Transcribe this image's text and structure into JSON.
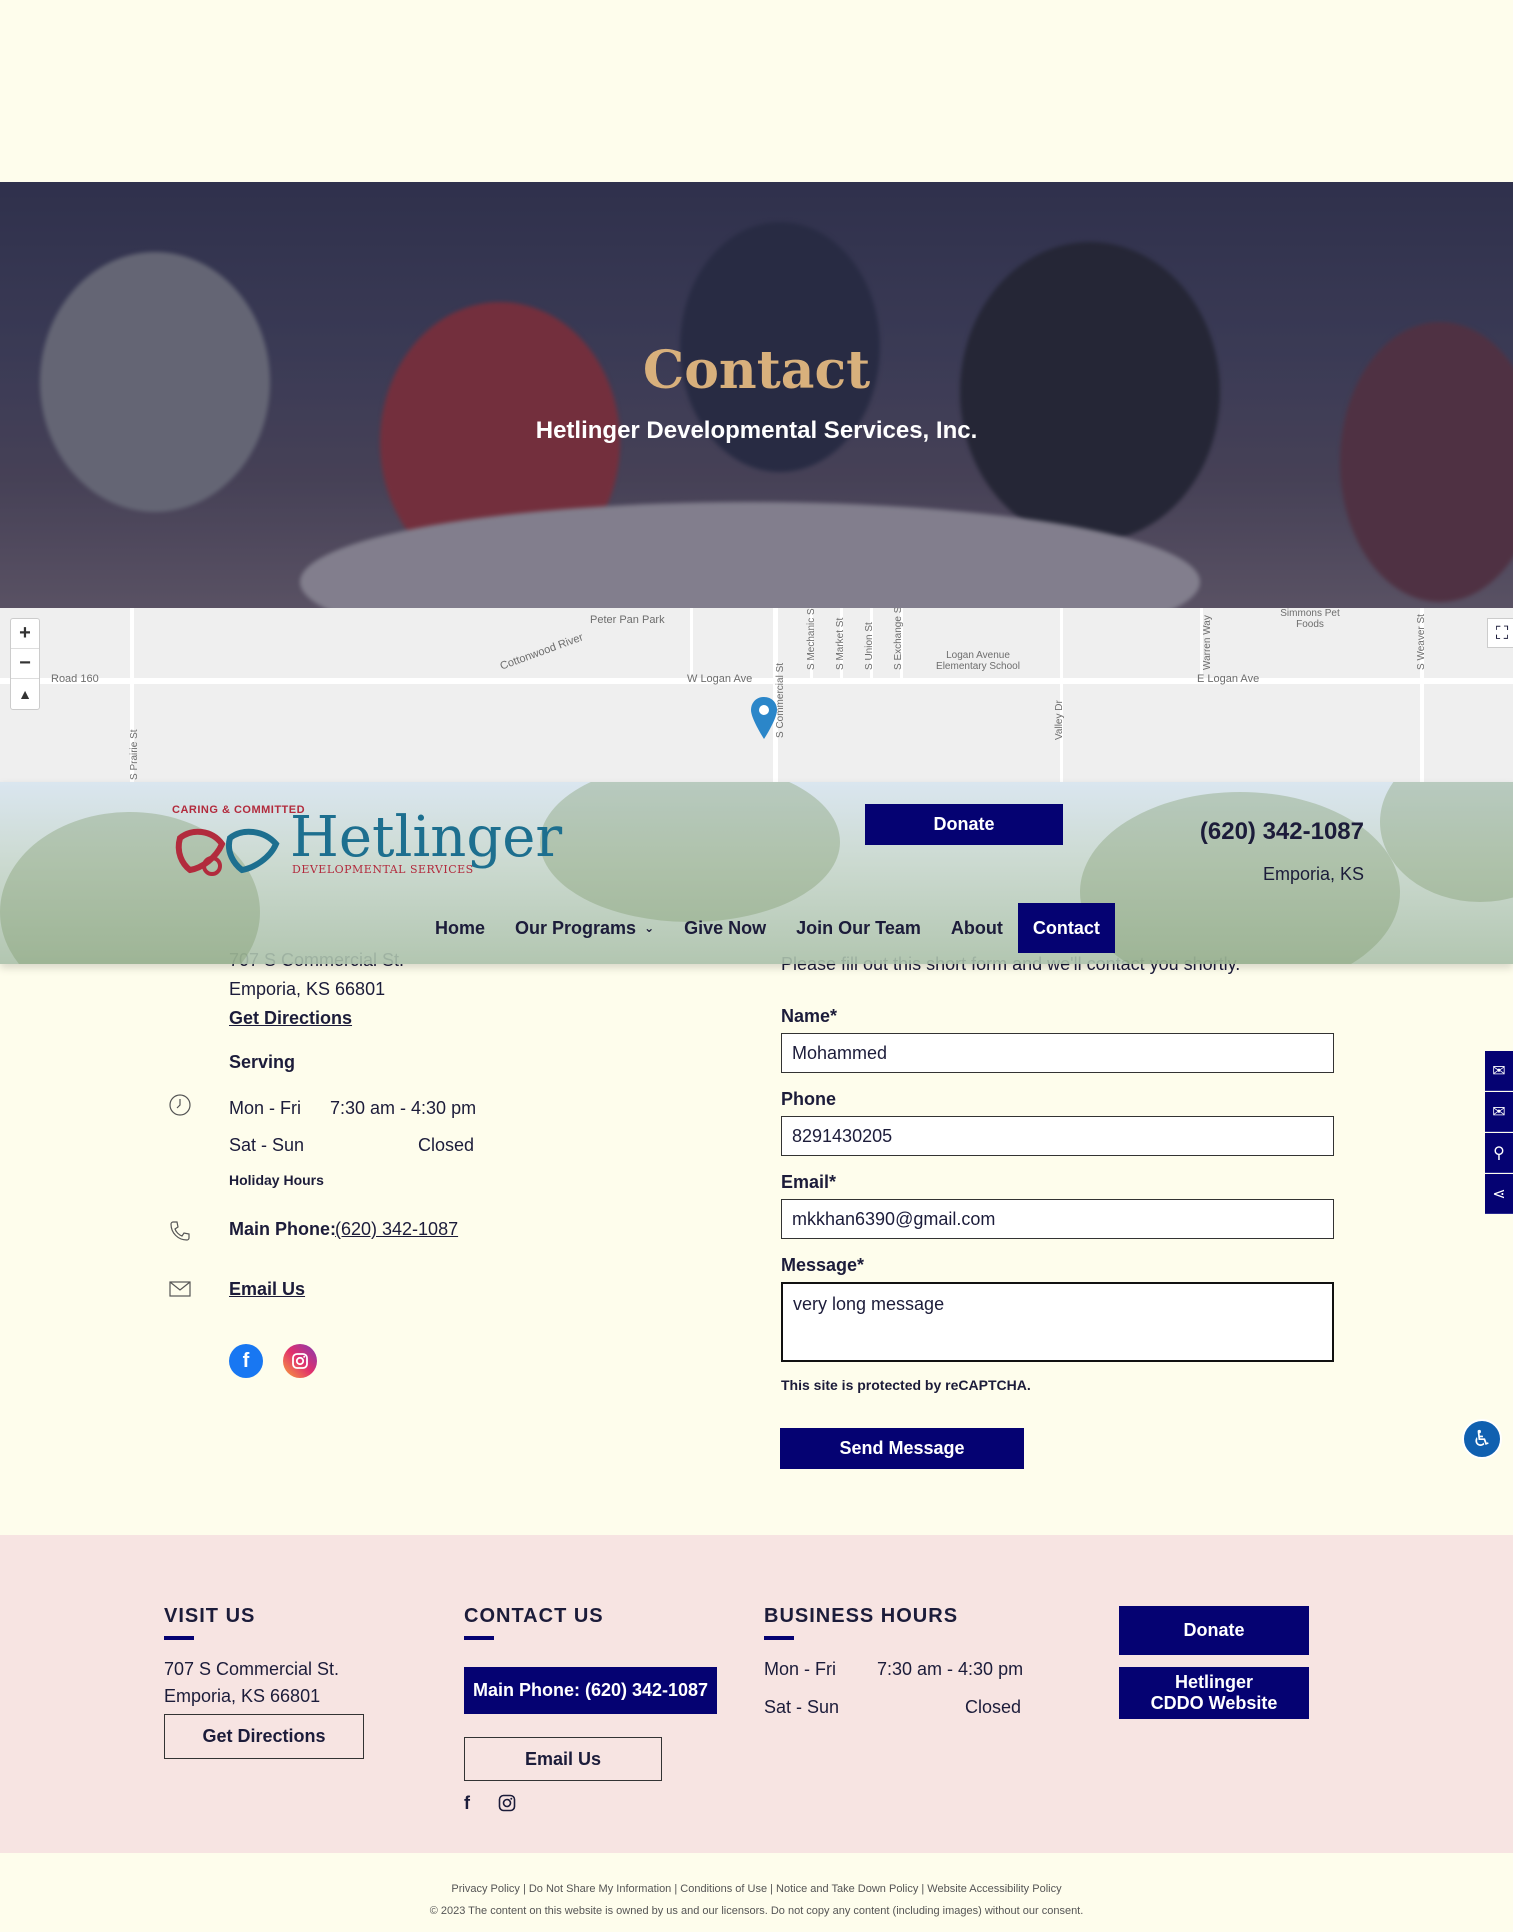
{
  "hero": {
    "title": "Contact",
    "subtitle": "Hetlinger Developmental Services, Inc."
  },
  "map": {
    "labels": {
      "peter_pan_park": "Peter Pan Park",
      "road_160": "Road 160",
      "cottonwood_river": "Cottonwood River",
      "w_logan_ave": "W Logan Ave",
      "logan_school": "Logan Avenue Elementary School",
      "e_logan_ave": "E Logan Ave",
      "simmons": "Simmons Pet Foods",
      "s_prairie": "S Prairie St",
      "s_commercial": "S Commercial St",
      "s_mechanic": "S Mechanic St",
      "s_market": "S Market St",
      "s_union": "S Union St",
      "s_exchange": "S Exchange St",
      "valley_dr": "Valley Dr",
      "warren_way": "Warren Way",
      "s_weaver": "S Weaver St"
    },
    "zoom_in": "+",
    "zoom_out": "−",
    "reset": "▲"
  },
  "header": {
    "logo_tagline": "CARING & COMMITTED",
    "logo_word": "Hetlinger",
    "logo_sub": "DEVELOPMENTAL SERVICES",
    "donate": "Donate",
    "phone": "(620) 342-1087",
    "city": "Emporia, KS"
  },
  "nav": {
    "items": [
      "Home",
      "Our Programs",
      "Give Now",
      "Join Our Team",
      "About",
      "Contact"
    ],
    "chevron": "⌄"
  },
  "contact": {
    "address_line1": "707 S Commercial St.",
    "address_line2": "Emporia, KS 66801",
    "directions": "Get Directions",
    "serving": "Serving",
    "hours": [
      {
        "days": "Mon - Fri",
        "time": "7:30 am - 4:30 pm"
      },
      {
        "days": "Sat - Sun",
        "time": "Closed"
      }
    ],
    "holiday": "Holiday Hours",
    "phone_label": "Main Phone:",
    "phone": "(620) 342-1087",
    "email": "Email Us"
  },
  "form": {
    "intro": "Please fill out this short form and we'll contact you shortly.",
    "name_label": "Name*",
    "name_value": "Mohammed",
    "phone_label": "Phone",
    "phone_value": "8291430205",
    "email_label": "Email*",
    "email_value": "mkkhan6390@gmail.com",
    "message_label": "Message*",
    "message_value": "very long message",
    "recaptcha": "This site is protected by reCAPTCHA.",
    "send": "Send Message"
  },
  "footer": {
    "visit_heading": "VISIT US",
    "visit_line1": "707 S Commercial St.",
    "visit_line2": "Emporia, KS 66801",
    "directions": "Get Directions",
    "contact_heading": "CONTACT US",
    "main_phone": "Main Phone: (620) 342-1087",
    "email": "Email Us",
    "hours_heading": "BUSINESS HOURS",
    "hours": [
      {
        "days": "Mon - Fri",
        "time": "7:30 am - 4:30 pm"
      },
      {
        "days": "Sat - Sun",
        "time": "Closed"
      }
    ],
    "donate": "Donate",
    "cddo": "Hetlinger CDDO Website",
    "legal_links": "Privacy Policy | Do Not Share My Information | Conditions of Use | Notice and Take Down Policy | Website Accessibility Policy",
    "copyright": "© 2023 The content on this website is owned by us and our licensors. Do not copy any content (including images) without our consent."
  },
  "colors": {
    "primary": "#050272",
    "page_bg": "#fefdec",
    "footer_bg": "#f7e4e2",
    "hero_title": "#d8b07c"
  }
}
